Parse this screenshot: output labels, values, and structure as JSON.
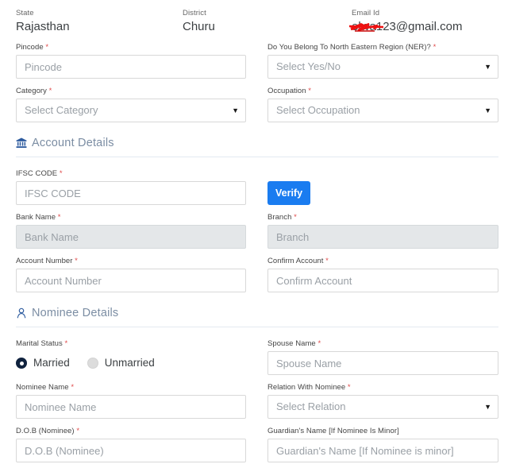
{
  "colors": {
    "accent_blue": "#1a7cf0",
    "section_icon": "#2c5a9e",
    "section_title": "#7b8da3",
    "required_asterisk": "#e04a4a",
    "disabled_bg": "#e4e7e9",
    "radio_selected": "#10233e",
    "redaction": "#ee1111"
  },
  "top_info": {
    "state": {
      "label": "State",
      "value": "Rajasthan"
    },
    "district": {
      "label": "District",
      "value": "Churu"
    },
    "email": {
      "label": "Email Id",
      "value": "elwa123@gmail.com",
      "redacted_prefix": true
    }
  },
  "personal": {
    "pincode": {
      "label": "Pincode",
      "required": "*",
      "placeholder": "Pincode",
      "value": ""
    },
    "ner": {
      "label": "Do You Belong To North Eastern Region (NER)?",
      "required": "*",
      "selected": "Select Yes/No",
      "caret": "▼"
    },
    "category": {
      "label": "Category",
      "required": "*",
      "selected": "Select Category",
      "caret": "▼"
    },
    "occupation": {
      "label": "Occupation",
      "required": "*",
      "selected": "Select Occupation",
      "caret": "▼"
    }
  },
  "account_section": {
    "title": "Account Details",
    "icon": "bank-icon",
    "ifsc": {
      "label": "IFSC CODE",
      "required": "*",
      "placeholder": "IFSC CODE",
      "value": ""
    },
    "verify_label": "Verify",
    "bank_name": {
      "label": "Bank Name",
      "required": "*",
      "placeholder": "Bank Name",
      "value": "",
      "disabled": true
    },
    "branch": {
      "label": "Branch",
      "required": "*",
      "placeholder": "Branch",
      "value": "",
      "disabled": true
    },
    "account_number": {
      "label": "Account Number",
      "required": "*",
      "placeholder": "Account Number",
      "value": ""
    },
    "confirm_account": {
      "label": "Confirm Account",
      "required": "*",
      "placeholder": "Confirm Account",
      "value": ""
    }
  },
  "nominee_section": {
    "title": "Nominee Details",
    "icon": "person-icon",
    "marital_status": {
      "label": "Marital Status",
      "required": "*",
      "options": [
        {
          "label": "Married",
          "selected": true
        },
        {
          "label": "Unmarried",
          "selected": false
        }
      ]
    },
    "spouse_name": {
      "label": "Spouse Name",
      "required": "*",
      "placeholder": "Spouse Name",
      "value": ""
    },
    "nominee_name": {
      "label": "Nominee Name",
      "required": "*",
      "placeholder": "Nominee Name",
      "value": ""
    },
    "relation": {
      "label": "Relation With Nominee",
      "required": "*",
      "selected": "Select Relation",
      "caret": "▼"
    },
    "dob": {
      "label": "D.O.B (Nominee)",
      "required": "*",
      "placeholder": "D.O.B (Nominee)",
      "value": ""
    },
    "guardian": {
      "label": "Guardian's Name [If Nominee Is Minor]",
      "required": "",
      "placeholder": "Guardian's Name [If Nominee is minor]",
      "value": ""
    }
  }
}
